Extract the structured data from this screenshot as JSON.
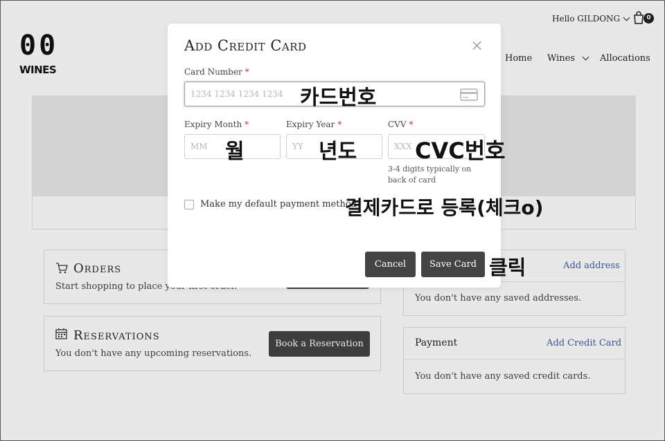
{
  "brand": {
    "logo_mark": "00",
    "logo_text": "WINES"
  },
  "header": {
    "greeting": "Hello GILDONG",
    "cart_count": "0"
  },
  "nav": {
    "home": "Home",
    "wines": "Wines",
    "allocations": "Allocations"
  },
  "orders": {
    "title": "Orders",
    "text": "Start shopping to place your first order."
  },
  "reservations": {
    "title": "Reservations",
    "text": "You don't have any upcoming reservations.",
    "button": "Book a Reservation"
  },
  "addresses": {
    "link": "Add address",
    "text": "You don't have any saved addresses."
  },
  "payment": {
    "title": "Payment",
    "link": "Add Credit Card",
    "text": "You don't have any saved credit cards."
  },
  "modal": {
    "title": "Add Credit Card",
    "card_number_label": "Card Number",
    "card_number_placeholder": "1234 1234 1234 1234",
    "expiry_month_label": "Expiry Month",
    "expiry_month_placeholder": "MM",
    "expiry_year_label": "Expiry Year",
    "expiry_year_placeholder": "YY",
    "cvv_label": "CVV",
    "cvv_placeholder": "XXX",
    "cvv_hint": "3-4 digits typically on back of card",
    "default_checkbox_label": "Make my default payment method",
    "required_mark": "*",
    "cancel_label": "Cancel",
    "save_label": "Save Card"
  },
  "annotations": {
    "card_number": "카드번호",
    "month": "월",
    "year": "년도",
    "cvc": "CVC번호",
    "checkbox": "결제카드로 등록(체크o)",
    "click": "클릭"
  },
  "colors": {
    "button_dark": "#444444",
    "link_blue": "#3d5fa8",
    "required_red": "#c0392b",
    "hero_gray": "#e7e7e7"
  }
}
